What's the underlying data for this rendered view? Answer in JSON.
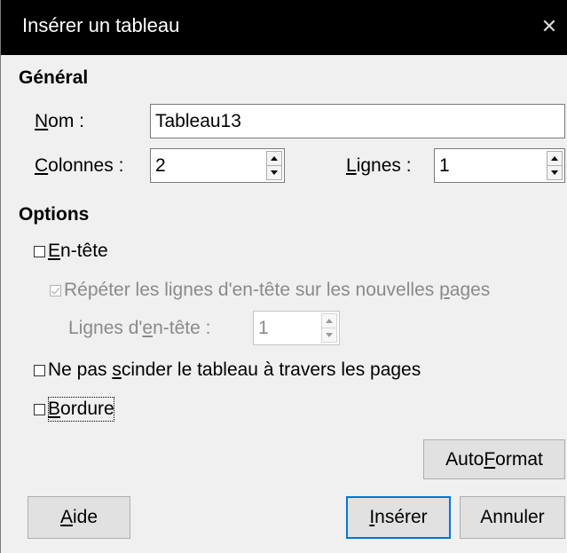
{
  "dialog": {
    "title": "Insérer un tableau",
    "close_glyph": "✕"
  },
  "general": {
    "heading": "Général",
    "name": {
      "label_ul": "N",
      "label_rest": "om :",
      "value": "Tableau13"
    },
    "columns": {
      "label_ul": "C",
      "label_rest": "olonnes :",
      "value": "2"
    },
    "rows": {
      "label_ul": "L",
      "label_rest": "ignes :",
      "value": "1"
    }
  },
  "options": {
    "heading": "Options",
    "header": {
      "label_ul": "E",
      "label_rest": "n-tête",
      "checked": false
    },
    "repeat_header": {
      "label_pre": "Répéter les lignes d'en-tête sur les nouvelles ",
      "label_ul": "p",
      "label_post": "ages",
      "checked": true,
      "disabled": true
    },
    "header_rows": {
      "label_pre": "Lignes d'",
      "label_ul": "e",
      "label_post": "n-tête :",
      "value": "1",
      "disabled": true
    },
    "dont_split": {
      "label_pre": "Ne pas ",
      "label_ul": "s",
      "label_post": "cinder le tableau à travers les pages",
      "checked": false
    },
    "border": {
      "label_ul": "B",
      "label_rest": "ordure",
      "checked": false
    }
  },
  "buttons": {
    "autoformat": {
      "pre": "Auto",
      "ul": "F",
      "post": "ormat"
    },
    "help": {
      "pre": "",
      "ul": "A",
      "post": "ide"
    },
    "insert": {
      "pre": "",
      "ul": "I",
      "post": "nsérer"
    },
    "cancel": {
      "pre": "Annuler",
      "ul": "",
      "post": ""
    }
  },
  "colors": {
    "titlebar_bg": "#000000",
    "titlebar_text": "#ffffff",
    "dialog_bg": "#f0f0f0",
    "default_button_border": "#0078d7",
    "disabled_text": "#8a8a8a"
  }
}
